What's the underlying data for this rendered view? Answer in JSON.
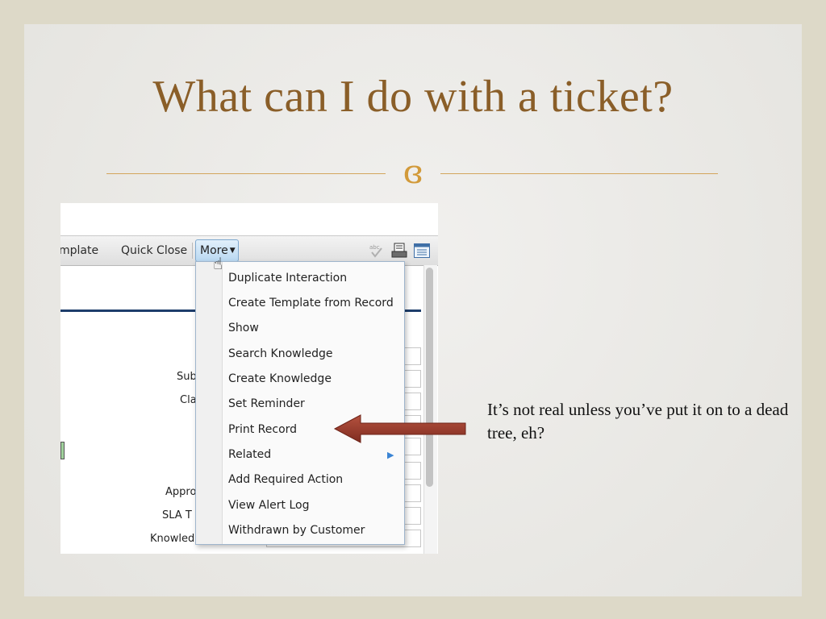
{
  "slide": {
    "title": "What can I do with a ticket?",
    "ornament": "ɞ",
    "caption": "It’s not real unless you’ve put it on to a dead tree, eh?"
  },
  "toolbar": {
    "template_label": "mplate",
    "quick_close_label": "Quick Close",
    "more_label": "More"
  },
  "form": {
    "labels": [
      "Sub",
      "Cla",
      "Appro",
      "SLA T",
      "Knowled"
    ]
  },
  "menu": {
    "items": [
      "Duplicate Interaction",
      "Create Template from Record",
      "Show",
      "Search Knowledge",
      "Create Knowledge",
      "Set Reminder",
      "Print Record",
      "Related",
      "Add Required Action",
      "View Alert Log",
      "Withdrawn by Customer"
    ]
  },
  "colors": {
    "title": "#8a5e28",
    "divider": "#d3a55c",
    "arrow": "#9b3a2a",
    "menu_border": "#9fb5cc"
  },
  "icons": [
    "spellcheck-icon",
    "print-icon",
    "list-view-icon",
    "hand-cursor-icon",
    "submenu-arrow-icon",
    "ornament-icon"
  ]
}
